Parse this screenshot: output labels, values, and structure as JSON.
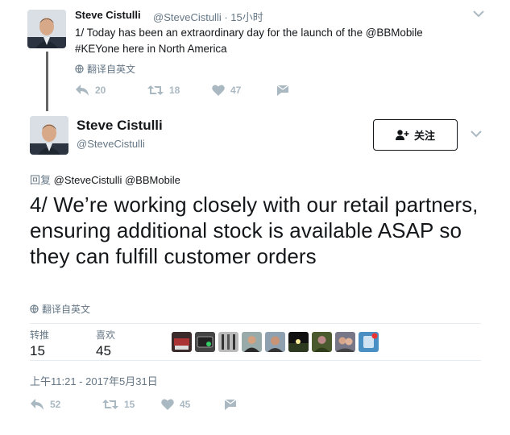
{
  "thread_tweet": {
    "author_name": "Steve Cistulli",
    "author_handle": "@SteveCistulli · 15小时",
    "text": "1/ Today has been an extraordinary day for the launch of the @BBMobile #KEYone here in North America",
    "translate_label": "翻译自英文",
    "reply_count": "20",
    "retweet_count": "18",
    "like_count": "47",
    "icons": [
      "reply-icon",
      "retweet-icon",
      "heart-icon",
      "direct-message-icon"
    ]
  },
  "main_tweet": {
    "author_name": "Steve Cistulli",
    "author_handle": "@SteveCistulli",
    "follow_label": "关注",
    "reply_prefix": "回复",
    "reply_mentions": "@SteveCistulli @BBMobile",
    "text": "4/ We’re working closely with our retail partners, ensuring additional stock is available ASAP so they can fulfill customer orders",
    "translate_label": "翻译自英文",
    "stats": {
      "retweets_label": "转推",
      "retweets_value": "15",
      "likes_label": "喜欢",
      "likes_value": "45"
    },
    "liker_avatar_count": 10,
    "timestamp": "上午11:21 - 2017年5月31日",
    "actions": {
      "reply_count": "52",
      "retweet_count": "15",
      "like_count": "45"
    }
  },
  "colors": {
    "text_primary": "#14171a",
    "text_secondary": "#657786",
    "action_gray": "#aab8c2",
    "divider": "#e6ecf0",
    "thread_line": "#666666"
  }
}
